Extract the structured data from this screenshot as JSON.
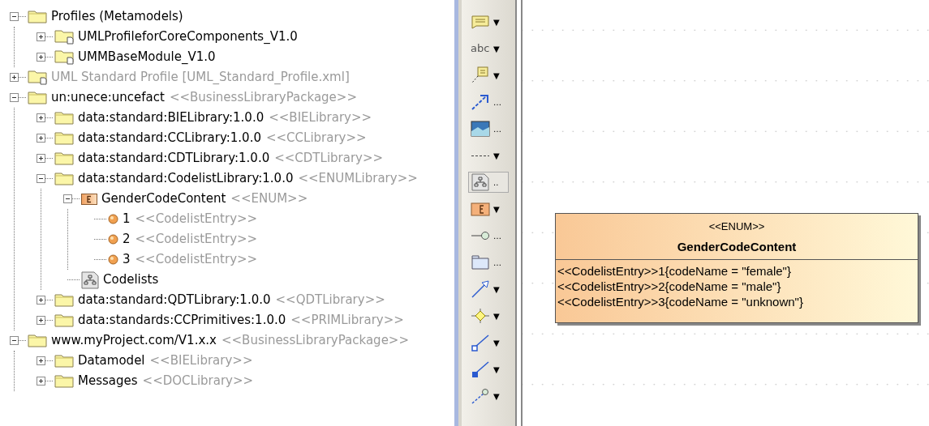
{
  "tree": [
    {
      "name": "Profiles (Metamodels)",
      "kind": "folder",
      "expanded": true,
      "children": [
        {
          "name": "UMLProfileforCoreComponents_V1.0",
          "kind": "profile",
          "expanded": false
        },
        {
          "name": "UMMBaseModule_V1.0",
          "kind": "profile",
          "expanded": false
        }
      ]
    },
    {
      "name": "UML Standard Profile [UML_Standard_Profile.xml]",
      "kind": "profile",
      "expanded": false,
      "disabled": true
    },
    {
      "name": "un:unece:uncefact",
      "stereotype": "<<BusinessLibraryPackage>>",
      "kind": "folder",
      "expanded": true,
      "children": [
        {
          "name": "data:standard:BIELibrary:1.0.0",
          "stereotype": "<<BIELibrary>>",
          "kind": "folder",
          "expanded": false
        },
        {
          "name": "data:standard:CCLibrary:1.0.0",
          "stereotype": "<<CCLibrary>>",
          "kind": "folder",
          "expanded": false
        },
        {
          "name": "data:standard:CDTLibrary:1.0.0",
          "stereotype": "<<CDTLibrary>>",
          "kind": "folder",
          "expanded": false
        },
        {
          "name": "data:standard:CodelistLibrary:1.0.0",
          "stereotype": "<<ENUMLibrary>>",
          "kind": "folder",
          "expanded": true,
          "children": [
            {
              "name": "GenderCodeContent",
              "stereotype": "<<ENUM>>",
              "kind": "enum",
              "expanded": true,
              "children": [
                {
                  "name": "1",
                  "stereotype": "<<CodelistEntry>>",
                  "kind": "literal"
                },
                {
                  "name": "2",
                  "stereotype": "<<CodelistEntry>>",
                  "kind": "literal"
                },
                {
                  "name": "3",
                  "stereotype": "<<CodelistEntry>>",
                  "kind": "literal"
                }
              ]
            },
            {
              "name": "Codelists",
              "kind": "diagram"
            }
          ]
        },
        {
          "name": "data:standard:QDTLibrary:1.0.0",
          "stereotype": "<<QDTLibrary>>",
          "kind": "folder",
          "expanded": false
        },
        {
          "name": "data:standards:CCPrimitives:1.0.0",
          "stereotype": "<<PRIMLibrary>>",
          "kind": "folder",
          "expanded": false
        }
      ]
    },
    {
      "name": "www.myProject.com/V1.x.x",
      "stereotype": "<<BusinessLibraryPackage>>",
      "kind": "folder",
      "expanded": true,
      "children": [
        {
          "name": "Datamodel",
          "stereotype": "<<BIELibrary>>",
          "kind": "folder",
          "expanded": false
        },
        {
          "name": "Messages",
          "stereotype": "<<DOCLibrary>>",
          "kind": "folder",
          "expanded": false
        }
      ]
    }
  ],
  "palette": [
    {
      "kind": "note",
      "more": "▼",
      "selected": false
    },
    {
      "kind": "text",
      "label": "abc",
      "more": "▼",
      "selected": false
    },
    {
      "kind": "anchored-note",
      "more": "▼",
      "selected": false
    },
    {
      "kind": "arrow",
      "more": "…",
      "selected": false
    },
    {
      "kind": "image",
      "more": "…",
      "selected": false
    },
    {
      "kind": "dashed-line",
      "more": "▼",
      "selected": false
    },
    {
      "kind": "diagram",
      "more": "..",
      "selected": true
    },
    {
      "kind": "enum",
      "more": "▼",
      "selected": false
    },
    {
      "kind": "interface",
      "more": "…",
      "selected": false
    },
    {
      "kind": "package",
      "more": "…",
      "selected": false
    },
    {
      "kind": "open-arrow",
      "more": "▼",
      "selected": false
    },
    {
      "kind": "diamond",
      "more": "▼",
      "selected": false
    },
    {
      "kind": "hollow-end-line",
      "more": "▼",
      "selected": false
    },
    {
      "kind": "filled-end-line",
      "more": "▼",
      "selected": false
    },
    {
      "kind": "pin-line",
      "more": "▼",
      "selected": false
    }
  ],
  "enum_box": {
    "stereotype": "<<ENUM>>",
    "name": "GenderCodeContent",
    "entries": [
      "<<CodelistEntry>>1{codeName = \"female\"}",
      "<<CodelistEntry>>2{codeName = \"male\"}",
      "<<CodelistEntry>>3{codeName = \"unknown\"}"
    ]
  }
}
